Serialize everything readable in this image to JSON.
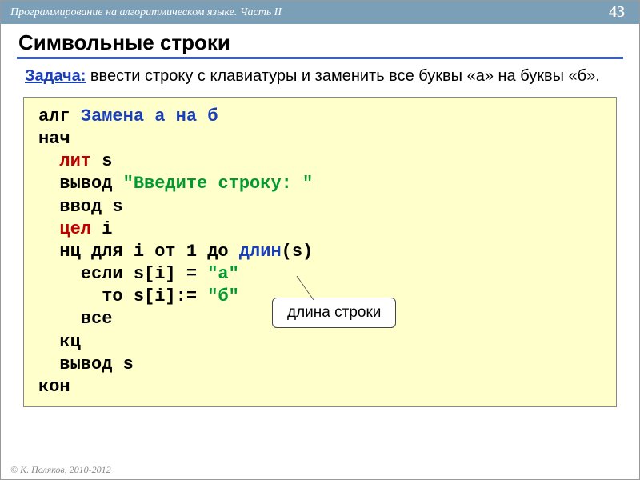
{
  "header": {
    "course": "Программирование на алгоритмическом языке. Часть II",
    "page": "43"
  },
  "title": "Символьные строки",
  "task": {
    "label": "Задача:",
    "text": " ввести строку с клавиатуры и заменить все буквы «а» на буквы «б»."
  },
  "code": {
    "l1a": "алг ",
    "l1b": "Замена а на б",
    "l2": "нач",
    "l3a": "  лит",
    "l3b": " s",
    "l4a": "  вывод ",
    "l4b": "\"Введите строку: \"",
    "l5": "  ввод s",
    "l6a": "  цел",
    "l6b": " i",
    "l7a": "  нц для i от 1 до ",
    "l7b": "длин",
    "l7c": "(s)",
    "l8a": "    если s[i] = ",
    "l8b": "\"а\"",
    "l9a": "      то s[i]:= ",
    "l9b": "\"б\"",
    "l10": "    все",
    "l11": "  кц",
    "l12": "  вывод s",
    "l13": "кон"
  },
  "callout": "длина строки",
  "footer": "© К. Поляков, 2010-2012"
}
